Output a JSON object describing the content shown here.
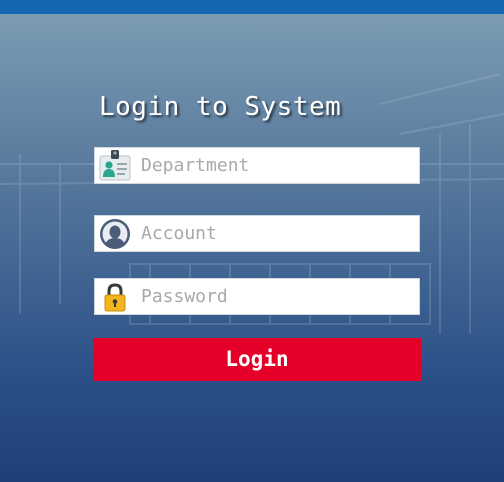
{
  "header": {
    "title": "Login to System"
  },
  "form": {
    "department": {
      "placeholder": "Department",
      "value": ""
    },
    "account": {
      "placeholder": "Account",
      "value": ""
    },
    "password": {
      "placeholder": "Password",
      "value": ""
    },
    "login_label": "Login"
  },
  "colors": {
    "top_bar": "#1566b3",
    "login_button": "#e5002a",
    "title_text": "#ffffff"
  },
  "icons": {
    "department": "id-badge-icon",
    "account": "user-avatar-icon",
    "password": "padlock-icon"
  }
}
